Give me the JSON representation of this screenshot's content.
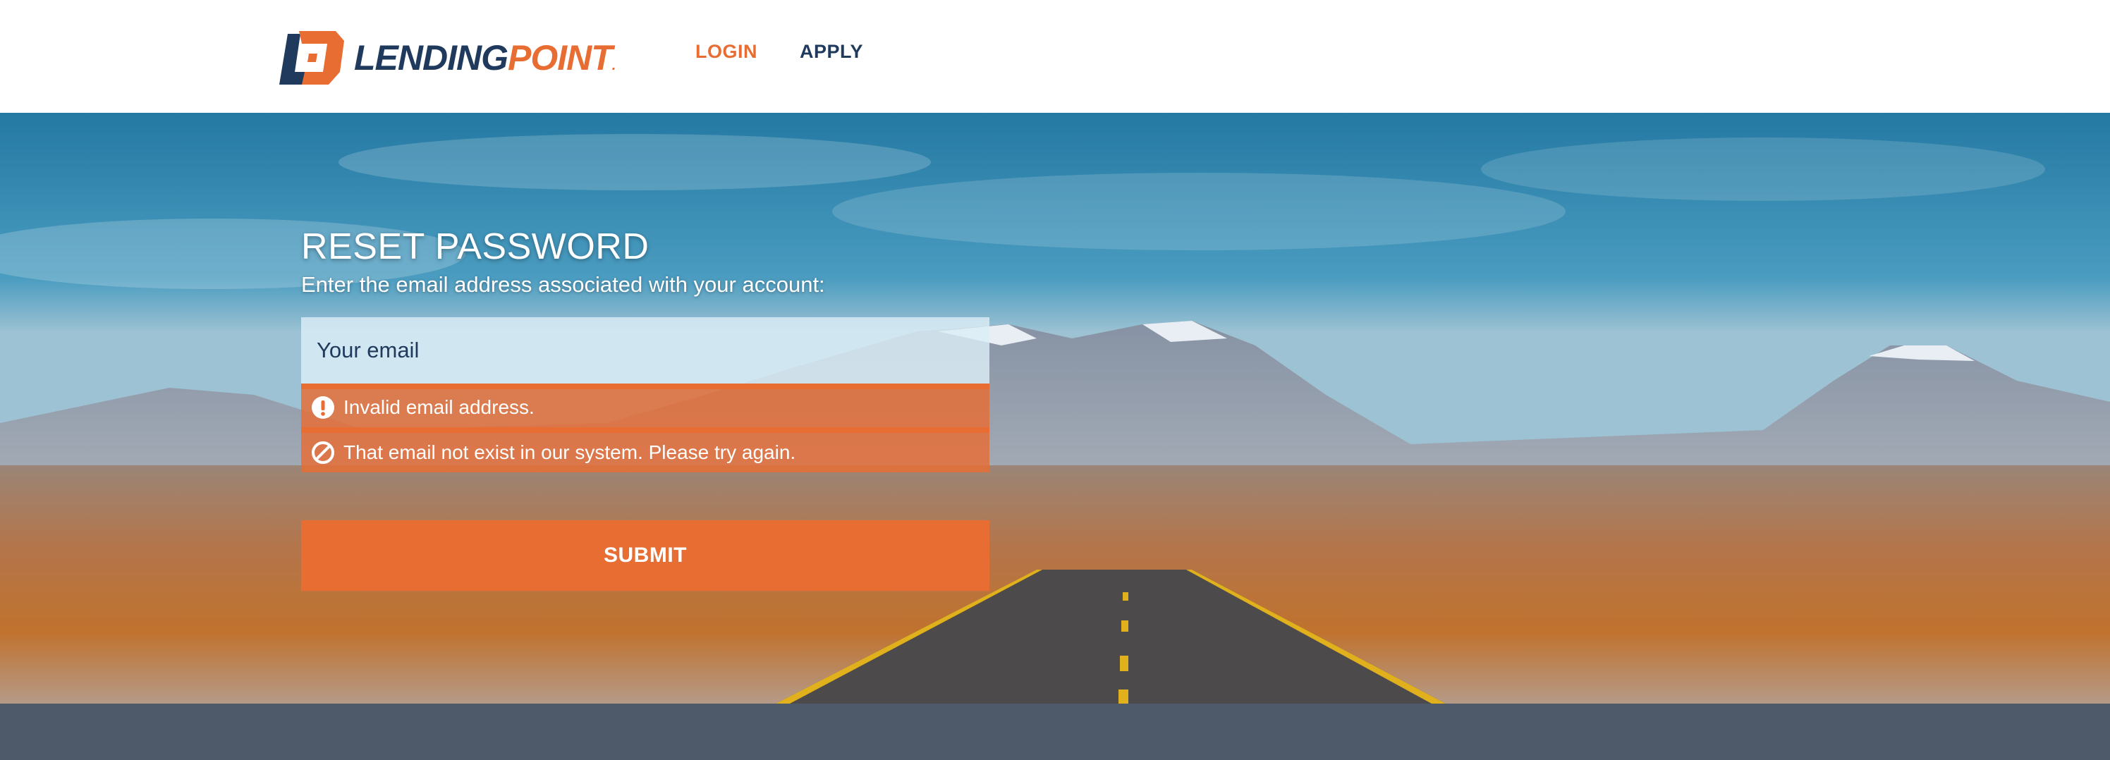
{
  "header": {
    "logo": {
      "text_main": "LENDING",
      "text_accent": "POINT",
      "trademark": "."
    },
    "nav": {
      "login": "LOGIN",
      "apply": "APPLY"
    }
  },
  "form": {
    "title": "RESET PASSWORD",
    "subtitle": "Enter the email address associated with your account:",
    "email_placeholder": "Your email",
    "email_value": "",
    "errors": [
      {
        "icon": "exclamation-circle-icon",
        "text": "Invalid email address."
      },
      {
        "icon": "prohibited-icon",
        "text": "That email not exist in our system. Please try again."
      }
    ],
    "submit_label": "SUBMIT"
  },
  "colors": {
    "brand_orange": "#e86d33",
    "brand_navy": "#1f3a5c",
    "footer": "#4e5a6a"
  }
}
